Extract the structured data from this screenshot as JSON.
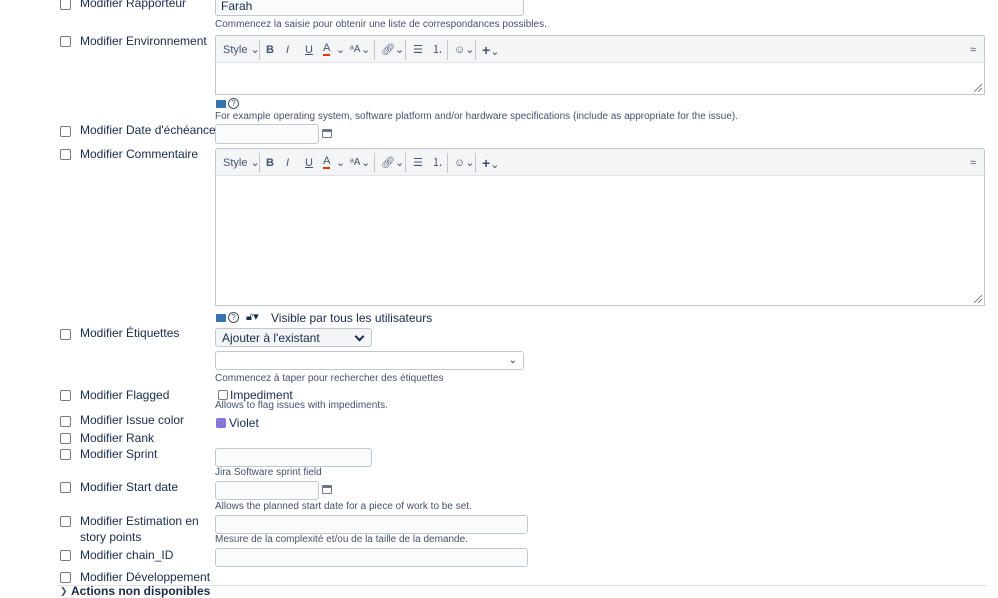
{
  "fields": {
    "rapporteur": {
      "label": "Modifier Rapporteur",
      "value": "Farah",
      "hint": "Commencez la saisie pour obtenir une liste de correspondances possibles."
    },
    "environnement": {
      "label": "Modifier Environnement",
      "hint": "For example operating system, software platform and/or hardware specifications (include as appropriate for the issue)."
    },
    "echeance": {
      "label": "Modifier Date d'échéance"
    },
    "commentaire": {
      "label": "Modifier Commentaire",
      "visibility": "Visible par tous les utilisateurs"
    },
    "etiquettes": {
      "label": "Modifier Étiquettes",
      "mode": "Ajouter à l'existant",
      "hint": "Commencez à taper pour rechercher des étiquettes"
    },
    "flagged": {
      "label": "Modifier Flagged",
      "option": "Impediment",
      "hint": "Allows to flag issues with impediments."
    },
    "issue_color": {
      "label": "Modifier Issue color",
      "value": "Violet",
      "color": "#8777d9"
    },
    "rank": {
      "label": "Modifier Rank"
    },
    "sprint": {
      "label": "Modifier Sprint",
      "hint": "Jira Software sprint field"
    },
    "start_date": {
      "label": "Modifier Start date",
      "hint": "Allows the planned start date for a piece of work to be set."
    },
    "estimation": {
      "label": "Modifier Estimation en story points",
      "hint": "Mesure de la complexité et/ou de la taille de la demande."
    },
    "chain_id": {
      "label": "Modifier chain_ID"
    },
    "developpement": {
      "label": "Modifier Développement"
    }
  },
  "toolbar": {
    "style": "Style",
    "bold": "B",
    "italic": "I",
    "underline": "U",
    "text_color": "A",
    "font_size": "ᵃA",
    "link_icon": "link-icon",
    "bullet_icon": "bullet-list-icon",
    "numbered_icon": "numbered-list-icon",
    "emoji_icon": "emoji-icon",
    "plus": "+",
    "collapse_icon": "collapse-icon"
  },
  "footer": {
    "label": "Actions non disponibles"
  }
}
